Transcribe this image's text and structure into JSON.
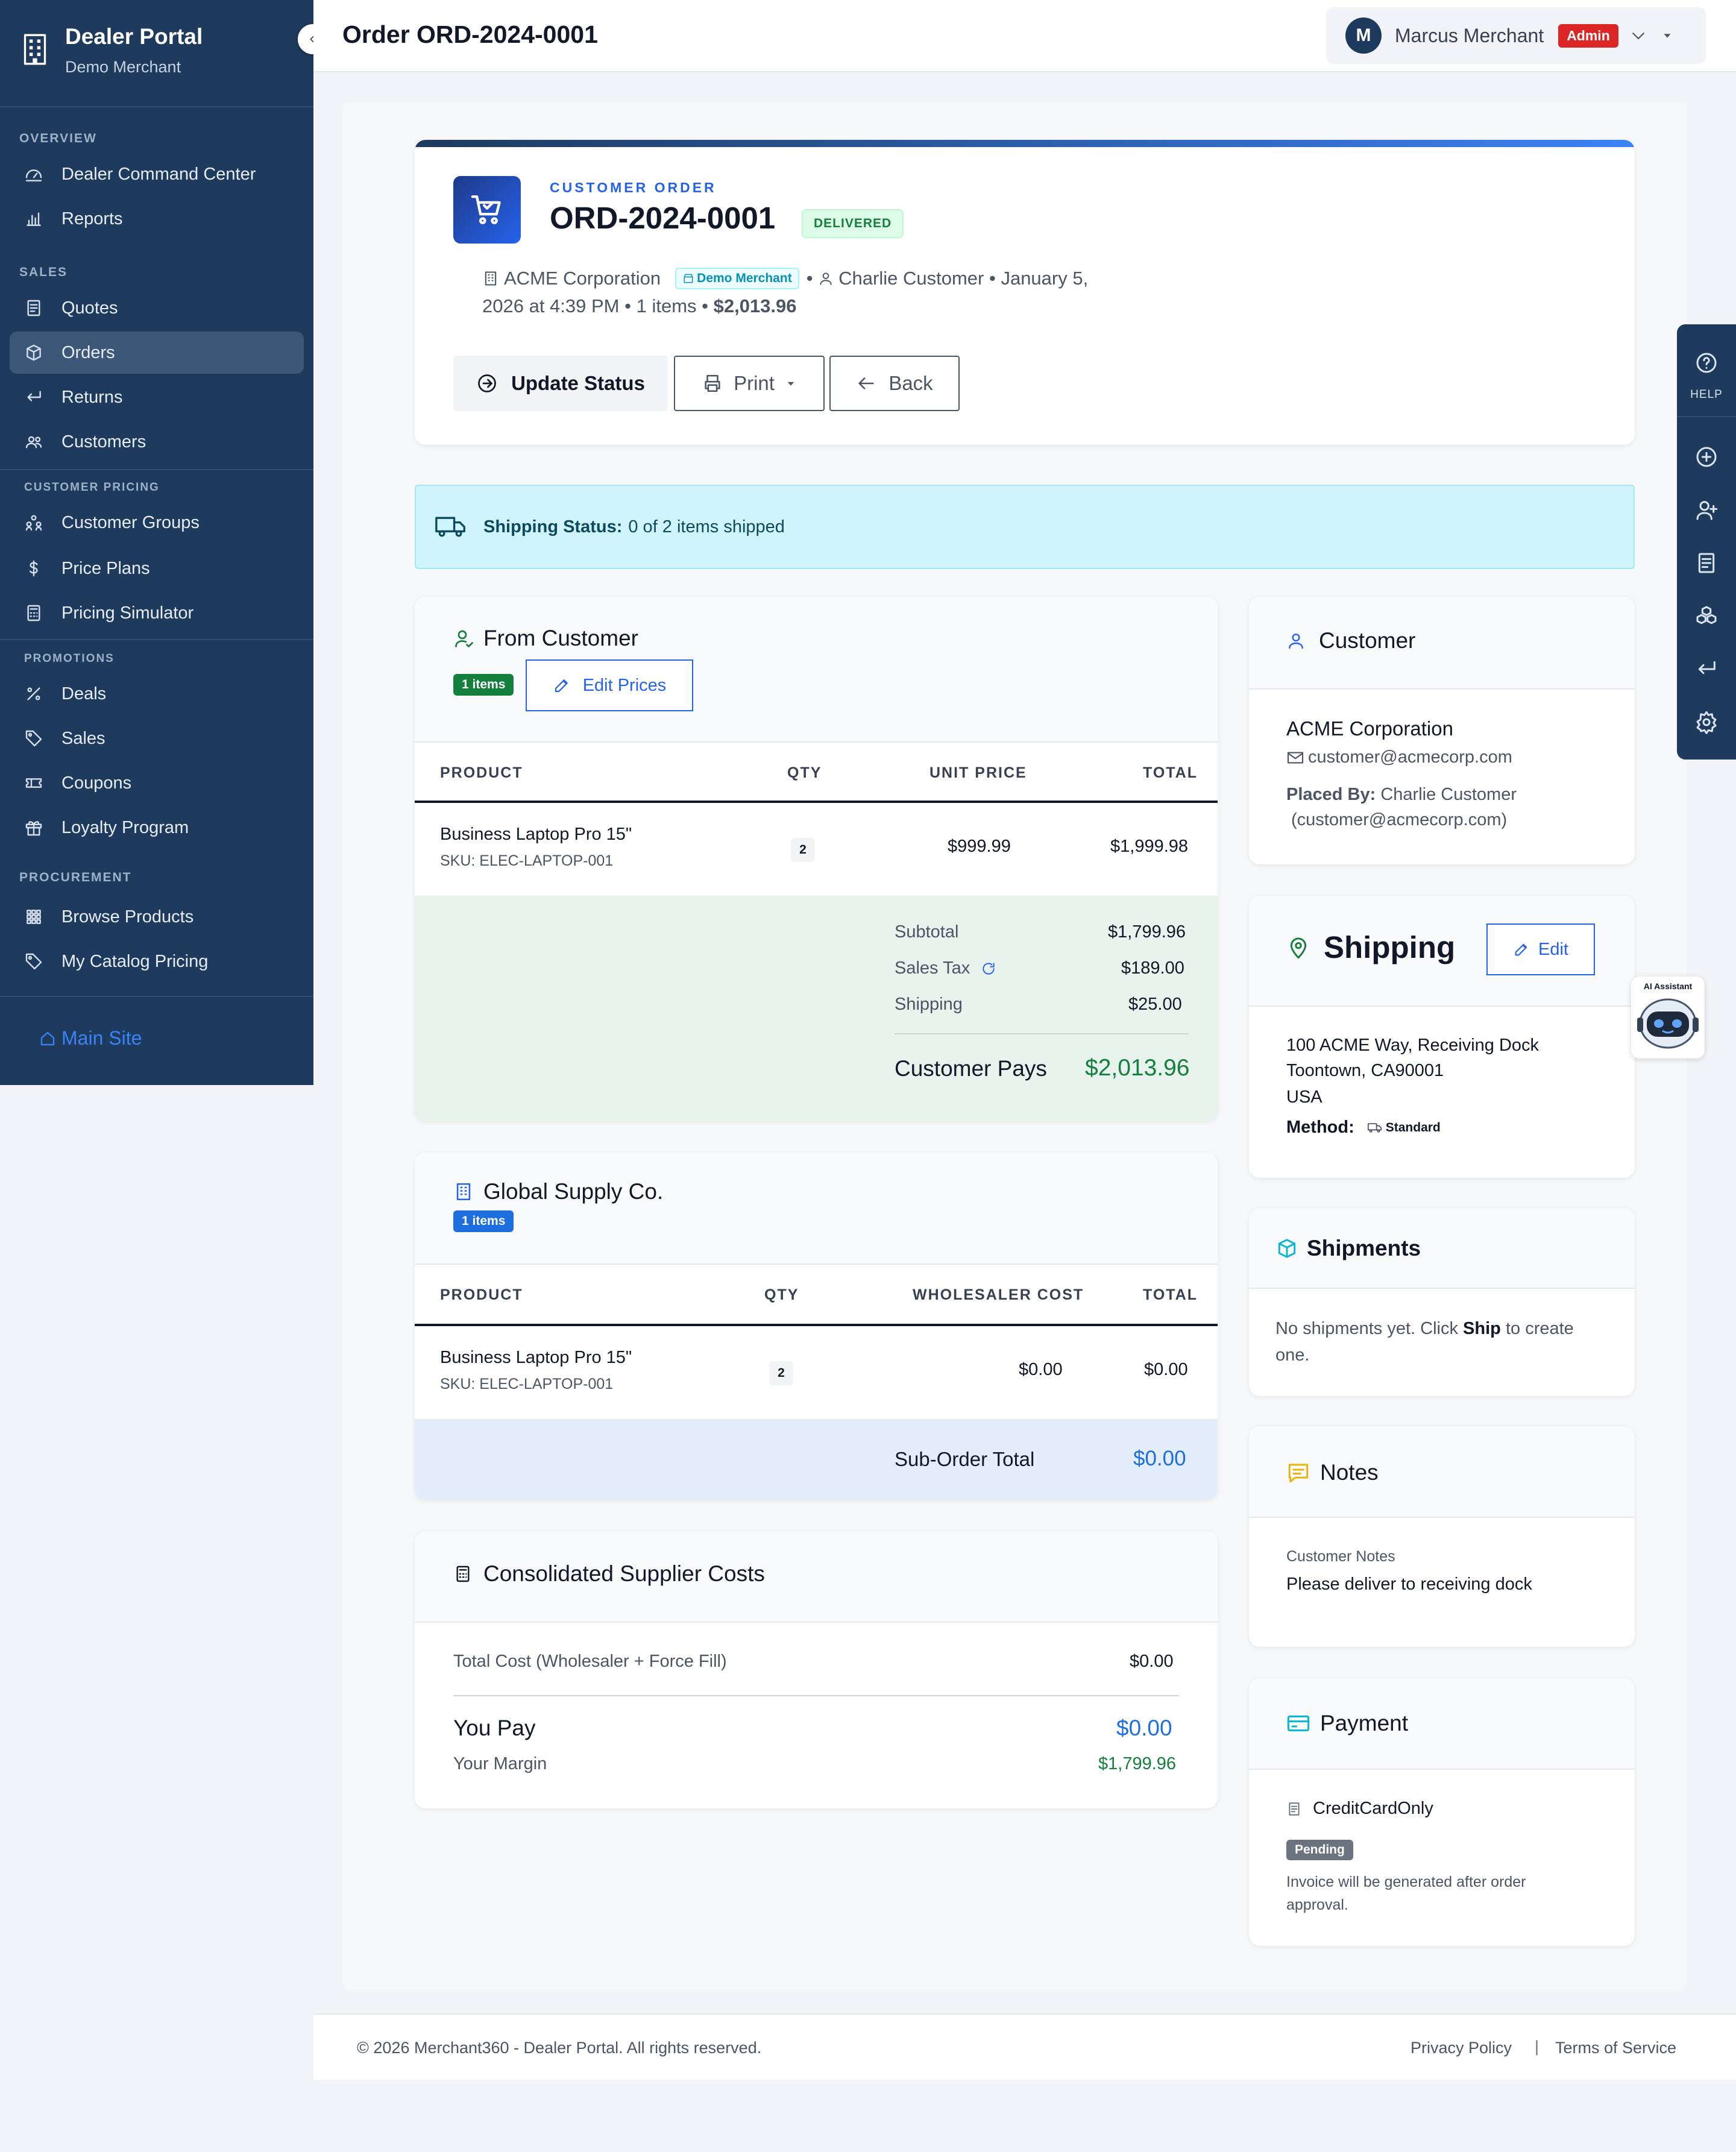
{
  "sidebar": {
    "title": "Dealer Portal",
    "subtitle": "Demo Merchant",
    "sections": {
      "overview": "OVERVIEW",
      "sales": "SALES",
      "customer_pricing": "CUSTOMER PRICING",
      "promotions": "PROMOTIONS",
      "procurement": "PROCUREMENT"
    },
    "items": {
      "command_center": "Dealer Command Center",
      "reports": "Reports",
      "quotes": "Quotes",
      "orders": "Orders",
      "returns": "Returns",
      "customers": "Customers",
      "customer_groups": "Customer Groups",
      "price_plans": "Price Plans",
      "pricing_simulator": "Pricing Simulator",
      "deals": "Deals",
      "sales": "Sales",
      "coupons": "Coupons",
      "loyalty": "Loyalty Program",
      "browse_products": "Browse Products",
      "catalog_pricing": "My Catalog Pricing"
    },
    "main_site": "Main Site"
  },
  "topbar": {
    "title": "Order ORD-2024-0001",
    "user_initial": "M",
    "user_name": "Marcus Merchant",
    "role": "Admin"
  },
  "order": {
    "label": "CUSTOMER ORDER",
    "number": "ORD-2024-0001",
    "status": "DELIVERED",
    "company": "ACME Corporation",
    "merchant": "Demo Merchant",
    "customer": "Charlie Customer",
    "date_part1": "January 5,",
    "date_part2": "2026 at 4:39 PM",
    "items": "1 items",
    "total": "$2,013.96",
    "btn_update": "Update Status",
    "btn_print": "Print",
    "btn_back": "Back"
  },
  "shipping_status": {
    "label": "Shipping Status:",
    "value": "0 of 2 items shipped"
  },
  "from_customer": {
    "title": "From Customer",
    "badge": "1 items",
    "edit": "Edit Prices",
    "headers": [
      "PRODUCT",
      "QTY",
      "UNIT PRICE",
      "TOTAL"
    ],
    "row": {
      "name": "Business Laptop Pro 15\"",
      "sku": "SKU: ELEC-LAPTOP-001",
      "qty": "2",
      "unit": "$999.99",
      "total": "$1,999.98"
    },
    "subtotal_label": "Subtotal",
    "subtotal": "$1,799.96",
    "tax_label": "Sales Tax",
    "tax": "$189.00",
    "shipping_label": "Shipping",
    "shipping": "$25.00",
    "pays_label": "Customer Pays",
    "pays": "$2,013.96"
  },
  "supplier": {
    "title": "Global Supply Co.",
    "badge": "1 items",
    "headers": [
      "PRODUCT",
      "QTY",
      "WHOLESALER COST",
      "TOTAL"
    ],
    "row": {
      "name": "Business Laptop Pro 15\"",
      "sku": "SKU: ELEC-LAPTOP-001",
      "qty": "2",
      "cost": "$0.00",
      "total": "$0.00"
    },
    "subtotal_label": "Sub-Order Total",
    "subtotal": "$0.00"
  },
  "consolidated": {
    "title": "Consolidated Supplier Costs",
    "total_label": "Total Cost (Wholesaler + Force Fill)",
    "total": "$0.00",
    "pay_label": "You Pay",
    "pay": "$0.00",
    "margin_label": "Your Margin",
    "margin": "$1,799.96"
  },
  "customer_card": {
    "title": "Customer",
    "company": "ACME Corporation",
    "email": "customer@acmecorp.com",
    "placed_by_label": "Placed By:",
    "placed_by": "Charlie Customer",
    "placed_email": "(customer@acmecorp.com)"
  },
  "shipping_card": {
    "title": "Shipping",
    "edit": "Edit",
    "line1": "100 ACME Way, Receiving Dock",
    "line2": "Toontown, CA90001",
    "line3": "USA",
    "method_label": "Method:",
    "method": "Standard"
  },
  "shipments_card": {
    "title": "Shipments",
    "text1": "No shipments yet. Click ",
    "bold": "Ship",
    "text2": " to create",
    "text3": "one."
  },
  "notes_card": {
    "title": "Notes",
    "label": "Customer Notes",
    "text": "Please deliver to receiving dock"
  },
  "payment_card": {
    "title": "Payment",
    "method": "CreditCardOnly",
    "status": "Pending",
    "note1": "Invoice will be generated after order",
    "note2": "approval."
  },
  "rail": {
    "help": "HELP"
  },
  "ai": {
    "label": "AI Assistant"
  },
  "footer": {
    "copyright": "© 2026 Merchant360 - Dealer Portal. All rights reserved.",
    "privacy": "Privacy Policy",
    "terms": "Terms of Service",
    "sep": "|"
  },
  "colors": {
    "sidebar": "#1e3a5c",
    "accent": "#2563eb",
    "success": "#15803d",
    "danger": "#dc2626"
  }
}
